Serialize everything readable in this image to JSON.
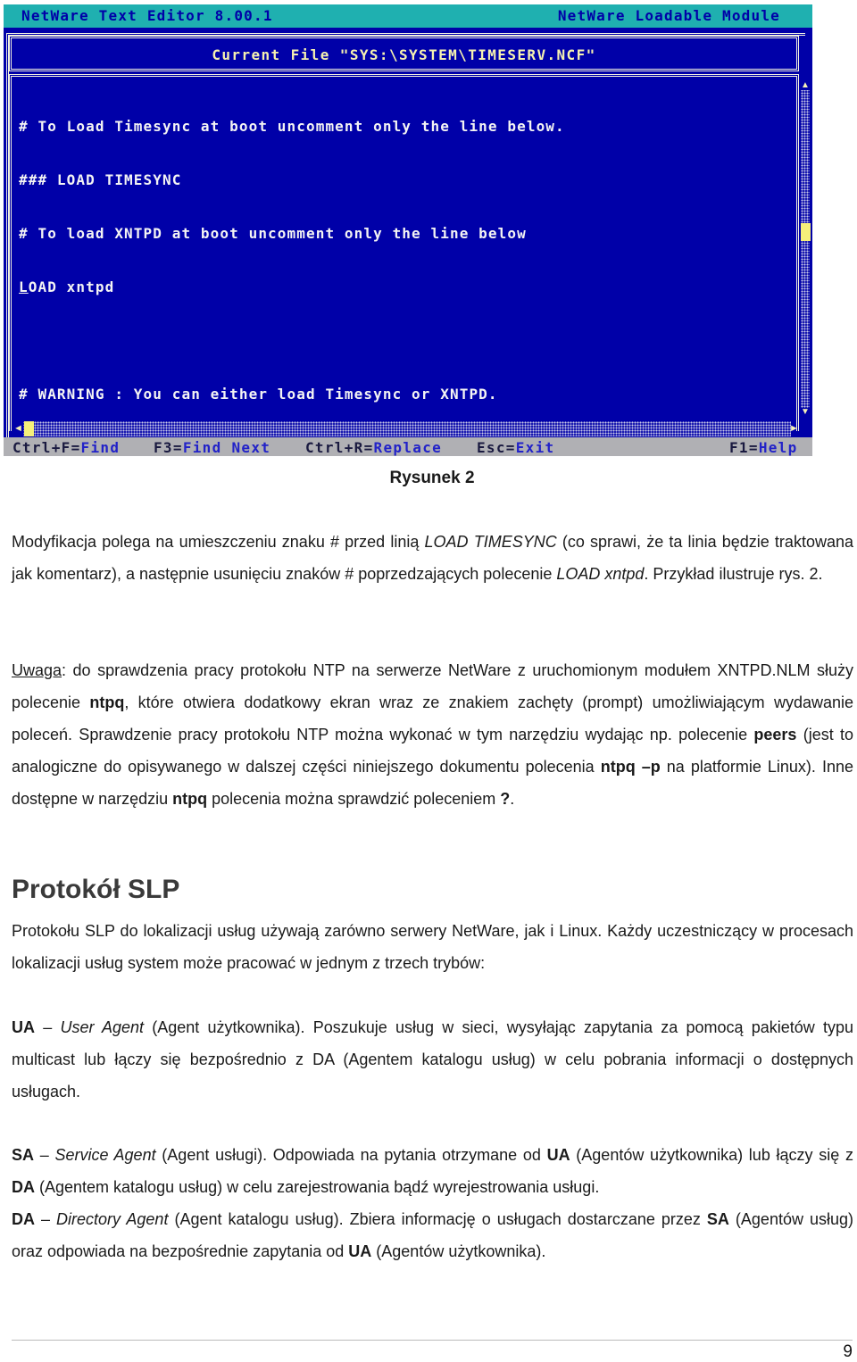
{
  "screenshot": {
    "title_left": "NetWare Text Editor  8.00.1",
    "title_right": "NetWare Loadable Module",
    "current_file": "Current File \"SYS:\\SYSTEM\\TIMESERV.NCF\"",
    "lines": [
      "# To Load Timesync at boot uncomment only the line below.",
      "### LOAD TIMESYNC",
      "# To load XNTPD at boot uncomment only the line below",
      "LOAD xntpd",
      "",
      "# WARNING : You can either load Timesync or XNTPD."
    ],
    "cursor_char": "L",
    "cursor_rest": "OAD xntpd",
    "status_items": [
      {
        "key": "Ctrl+F=",
        "action": "Find"
      },
      {
        "key": "F3=",
        "action": "Find Next"
      },
      {
        "key": "Ctrl+R=",
        "action": "Replace"
      },
      {
        "key": "Esc=",
        "action": "Exit"
      },
      {
        "key": "F1=",
        "action": "Help"
      }
    ],
    "colors": {
      "background": "#0000a8",
      "titlebar": "#1fb0b0",
      "statusbar": "#b0b0b4",
      "accent": "#f5ef7a"
    }
  },
  "caption": "Rysunek 2",
  "p1": {
    "t1": "Modyfikacja polega na umieszczeniu znaku # przed linią ",
    "i1": "LOAD TIMESYNC",
    "t2": " (co sprawi, że ta linia będzie traktowana jak komentarz), a następnie usunięciu znaków # poprzedzających polecenie ",
    "i2": "LOAD xntpd",
    "t3": ". Przykład ilustruje rys. 2."
  },
  "p2": {
    "u1": "Uwaga",
    "t1": ": do sprawdzenia pracy protokołu NTP na serwerze NetWare z uruchomionym modułem XNTPD.NLM służy polecenie ",
    "b1": "ntpq",
    "t2": ", które otwiera dodatkowy ekran wraz ze znakiem zachęty (prompt) umożliwiającym wydawanie poleceń. Sprawdzenie pracy protokołu NTP można wykonać w tym narzędziu wydając np. polecenie ",
    "b2": "peers",
    "t3": " (jest to analogiczne do opisywanego w dalszej części niniejszego dokumentu polecenia ",
    "b3": "ntpq –p",
    "t4": " na platformie Linux). Inne dostępne w narzędziu ",
    "b4": "ntpq",
    "t5": " polecenia można sprawdzić poleceniem ",
    "b5": "?",
    "t6": "."
  },
  "section_title": "Protokół SLP",
  "p3": "Protokołu SLP do lokalizacji usług używają zarówno serwery NetWare, jak i Linux. Każdy uczestniczący w procesach lokalizacji usług system może pracować w jednym z trzech trybów:",
  "ua": {
    "abbr": "UA",
    "dash": " – ",
    "name": "User Agent",
    "text": " (Agent użytkownika). Poszukuje usług w sieci, wysyłając zapytania za pomocą pakietów typu multicast lub łączy się bezpośrednio z DA (Agentem katalogu usług) w celu pobrania informacji o dostępnych usługach."
  },
  "sa": {
    "abbr": "SA",
    "dash": " – ",
    "name": "Service Agent",
    "t1": " (Agent usługi). Odpowiada na pytania otrzymane od ",
    "b1": "UA",
    "t2": " (Agentów użytkownika) lub łączy się z ",
    "b2": "DA",
    "t3": " (Agentem katalogu usług) w celu zarejestrowania bądź wyrejestrowania usługi."
  },
  "da": {
    "abbr": "DA",
    "dash": " – ",
    "name": "Directory Agent",
    "t1": " (Agent katalogu usług). Zbiera informację o usługach dostarczane przez ",
    "b1": "SA",
    "t2": " (Agentów usług) oraz odpowiada na bezpośrednie zapytania od ",
    "b2": "UA",
    "t3": " (Agentów użytkownika)."
  },
  "page_number": "9"
}
